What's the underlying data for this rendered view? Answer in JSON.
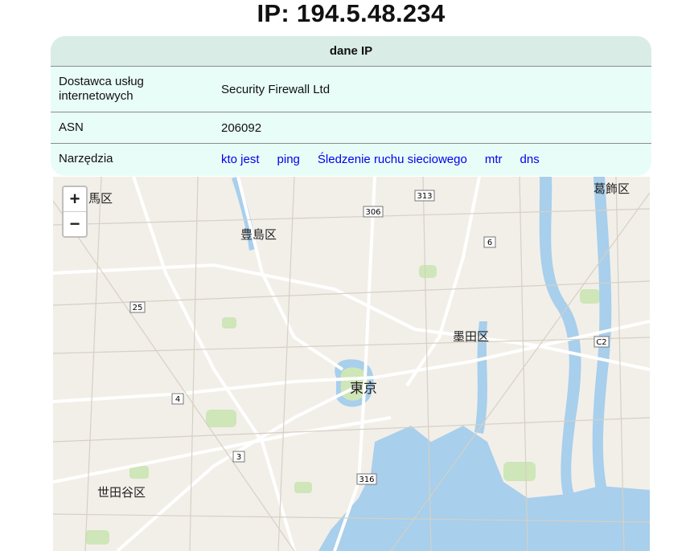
{
  "page": {
    "title": "IP: 194.5.48.234"
  },
  "info_table": {
    "header": "dane IP",
    "rows": [
      {
        "label": "Dostawca usług internetowych",
        "value": "Security Firewall Ltd"
      },
      {
        "label": "ASN",
        "value": "206092"
      }
    ],
    "tools_label": "Narzędzia",
    "tools": [
      "kto jest",
      "ping",
      "Śledzenie ruchu sieciowego",
      "mtr",
      "dns"
    ]
  },
  "map": {
    "zoom_in": "+",
    "zoom_out": "−",
    "labels": {
      "katsushika": "葛飾区",
      "toshima": "豊島区",
      "sumida": "墨田区",
      "tokyo": "東京",
      "setagaya": "世田谷区",
      "nerima_partial": "馬区"
    },
    "shields": {
      "r313": "313",
      "r306": "306",
      "r6": "6",
      "r25": "25",
      "r4": "4",
      "r3": "3",
      "r316": "316",
      "c2": "C2"
    },
    "colors": {
      "water": "#a8cfec",
      "land": "#f2efe9",
      "park": "#cfe6b8"
    }
  }
}
